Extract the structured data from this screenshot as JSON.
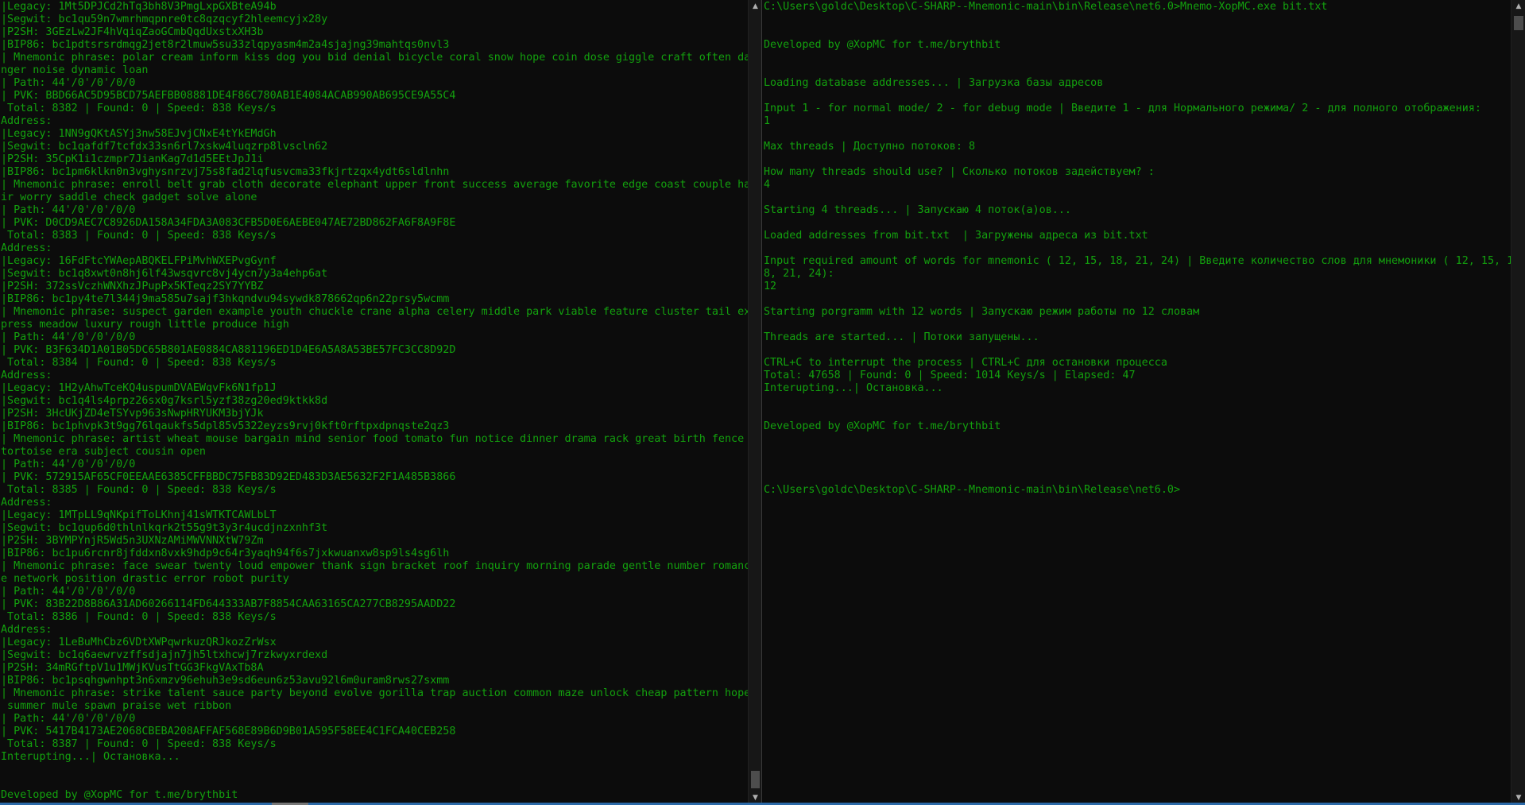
{
  "left_terminal": {
    "lines": [
      "|Legacy: 1Mt5DPJCd2hTq3bh8V3PmgLxpGXBteA94b",
      "|Segwit: bc1qu59n7wmrhmqpnre0tc8qzqcyf2hleemcyjx28y",
      "|P2SH: 3GEzLw2JF4hVqiqZaoGCmbQqdUxstxXH3b",
      "|BIP86: bc1pdtsrsrdmqg2jet8r2lmuw5su33zlqpyasm4m2a4sjajng39mahtqs0nvl3",
      "| Mnemonic phrase: polar cream inform kiss dog you bid denial bicycle coral snow hope coin dose giggle craft often da",
      "nger noise dynamic loan",
      "| Path: 44'/0'/0'/0/0",
      "| PVK: BBD66AC5D95BCD75AEFBB08881DE4F86C780AB1E4084ACAB990AB695CE9A55C4",
      " Total: 8382 | Found: 0 | Speed: 838 Keys/s",
      "Address:",
      "|Legacy: 1NN9gQKtASYj3nw58EJvjCNxE4tYkEMdGh",
      "|Segwit: bc1qafdf7tcfdx33sn6rl7xskw4luqzrp8lvscln62",
      "|P2SH: 35CpK1i1czmpr7JianKag7d1d5EEtJpJ1i",
      "|BIP86: bc1pm6klkn0n3vghysnrzvj75s8fad2lqfusvcma33fkjrtzqx4ydt6sldlnhn",
      "| Mnemonic phrase: enroll belt grab cloth decorate elephant upper front success average favorite edge coast couple ha",
      "ir worry saddle check gadget solve alone",
      "| Path: 44'/0'/0'/0/0",
      "| PVK: D0CD9AEC7C8926DA158A34FDA3A083CFB5D0E6AEBE047AE72BD862FA6F8A9F8E",
      " Total: 8383 | Found: 0 | Speed: 838 Keys/s",
      "Address:",
      "|Legacy: 16FdFtcYWAepABQKELFPiMvhWXEPvgGynf",
      "|Segwit: bc1q8xwt0n8hj6lf43wsqvrc8vj4ycn7y3a4ehp6at",
      "|P2SH: 372ssVczhWNXhzJPupPx5KTeqz2SY7YYBZ",
      "|BIP86: bc1py4te7l344j9ma585u7sajf3hkqndvu94sywdk878662qp6n22prsy5wcmm",
      "| Mnemonic phrase: suspect garden example youth chuckle crane alpha celery middle park viable feature cluster tail ex",
      "press meadow luxury rough little produce high",
      "| Path: 44'/0'/0'/0/0",
      "| PVK: B3F634D1A01B05DC65B801AE0884CA881196ED1D4E6A5A8A53BE57FC3CC8D92D",
      " Total: 8384 | Found: 0 | Speed: 838 Keys/s",
      "Address:",
      "|Legacy: 1H2yAhwTceKQ4uspumDVAEWqvFk6N1fp1J",
      "|Segwit: bc1q4ls4prpz26sx0g7ksrl5yzf38zg20ed9ktkk8d",
      "|P2SH: 3HcUKjZD4eTSYvp963sNwpHRYUKM3bjYJk",
      "|BIP86: bc1phvpk3t9gg76lqaukfs5dpl85v5322eyzs9rvj0kft0rftpxdpnqste2qz3",
      "| Mnemonic phrase: artist wheat mouse bargain mind senior food tomato fun notice dinner drama rack great birth fence",
      "tortoise era subject cousin open",
      "| Path: 44'/0'/0'/0/0",
      "| PVK: 572915AF65CF0EEAAE6385CFFBBDC75FB83D92ED483D3AE5632F2F1A485B3866",
      " Total: 8385 | Found: 0 | Speed: 838 Keys/s",
      "Address:",
      "|Legacy: 1MTpLL9qNKpifToLKhnj41sWTKTCAWLbLT",
      "|Segwit: bc1qup6d0thlnlkqrk2t55g9t3y3r4ucdjnzxnhf3t",
      "|P2SH: 3BYMPYnjR5Wd5n3UXNzAMiMWVNNXtW79Zm",
      "|BIP86: bc1pu6rcnr8jfddxn8vxk9hdp9c64r3yaqh94f6s7jxkwuanxw8sp9ls4sg6lh",
      "| Mnemonic phrase: face swear twenty loud empower thank sign bracket roof inquiry morning parade gentle number romanc",
      "e network position drastic error robot purity",
      "| Path: 44'/0'/0'/0/0",
      "| PVK: 83B22D8B86A31AD60266114FD644333AB7F8854CAA63165CA277CB8295AADD22",
      " Total: 8386 | Found: 0 | Speed: 838 Keys/s",
      "Address:",
      "|Legacy: 1LeBuMhCbz6VDtXWPqwrkuzQRJkozZrWsx",
      "|Segwit: bc1q6aewrvzffsdjajn7jh5ltxhcwj7rzkwyxrdexd",
      "|P2SH: 34mRGftpV1u1MWjKVusTtGG3FkgVAxTb8A",
      "|BIP86: bc1psqhgwnhpt3n6xmzv96ehuh3e9sd6eun6z53avu92l6m0uram8rws27sxmm",
      "| Mnemonic phrase: strike talent sauce party beyond evolve gorilla trap auction common maze unlock cheap pattern hope",
      " summer mule spawn praise wet ribbon",
      "| Path: 44'/0'/0'/0/0",
      "| PVK: 5417B4173AE2068CBEBA208AFFAF568E89B6D9B01A595F58EE4C1FCA40CEB258",
      " Total: 8387 | Found: 0 | Speed: 838 Keys/s",
      "Interupting...| Остановка...",
      "",
      "",
      "Developed by @XopMC for t.me/brythbit"
    ]
  },
  "right_terminal": {
    "lines": [
      "C:\\Users\\goldc\\Desktop\\C-SHARP--Mnemonic-main\\bin\\Release\\net6.0>Mnemo-XopMC.exe bit.txt",
      "",
      "",
      "Developed by @XopMC for t.me/brythbit",
      "",
      "",
      "Loading database addresses... | Загрузка базы адресов",
      "",
      "Input 1 - for normal mode/ 2 - for debug mode | Введите 1 - для Нормального режима/ 2 - для полного отображения:",
      "1",
      "",
      "Max threads | Доступно потоков: 8",
      "",
      "How many threads should use? | Сколько потоков задействуем? :",
      "4",
      "",
      "Starting 4 threads... | Запускаю 4 поток(а)ов...",
      "",
      "Loaded addresses from bit.txt  | Загружены адреса из bit.txt",
      "",
      "Input required amount of words for mnemonic ( 12, 15, 18, 21, 24) | Введите количество слов для мнемоники ( 12, 15, 1",
      "8, 21, 24):",
      "12",
      "",
      "Starting porgramm with 12 words | Запускаю режим работы по 12 словам",
      "",
      "Threads are started... | Потоки запущены...",
      "",
      "CTRL+C to interrupt the process | CTRL+C для остановки процесса",
      "Total: 47658 | Found: 0 | Speed: 1014 Keys/s | Elapsed: 47",
      "Interupting...| Остановка...",
      "",
      "",
      "Developed by @XopMC for t.me/brythbit",
      "",
      "",
      "",
      "",
      "C:\\Users\\goldc\\Desktop\\C-SHARP--Mnemonic-main\\bin\\Release\\net6.0>"
    ]
  },
  "scrollbar": {
    "up_icon": "▲",
    "down_icon": "▼"
  },
  "colors": {
    "background": "#0c0c0c",
    "text": "#13a10e"
  }
}
